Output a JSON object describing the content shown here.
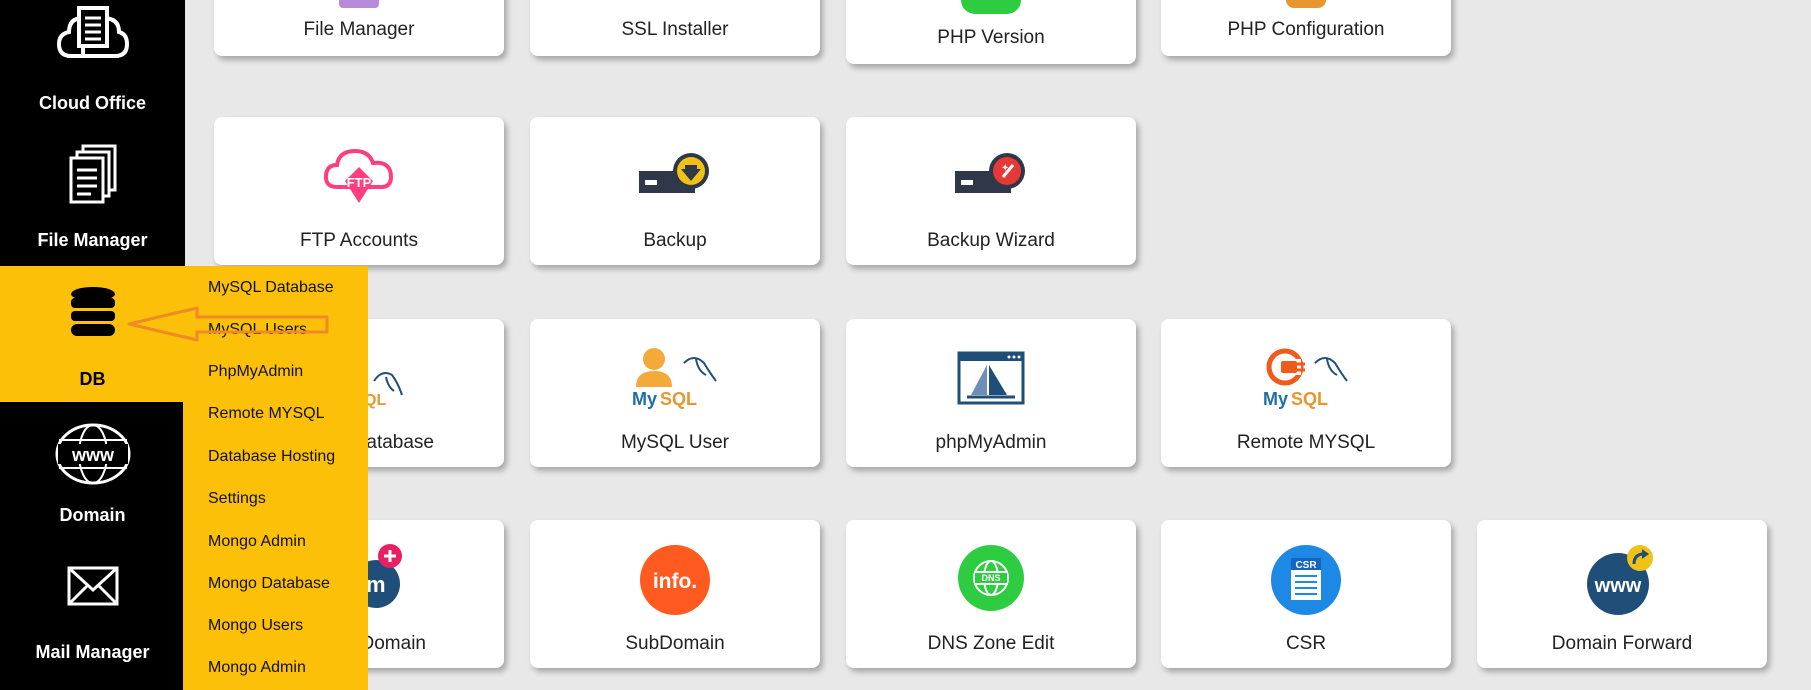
{
  "sidebar": {
    "items": [
      {
        "label": "Cloud Office",
        "icon": "cloud-office-icon"
      },
      {
        "label": "File Manager",
        "icon": "file-manager-icon"
      },
      {
        "label": "DB",
        "icon": "database-icon",
        "active": true
      },
      {
        "label": "Domain",
        "icon": "www-globe-icon"
      },
      {
        "label": "Mail Manager",
        "icon": "mail-envelope-icon"
      }
    ]
  },
  "submenu": {
    "items": [
      "MySQL Database",
      "MySQL Users",
      "PhpMyAdmin",
      "Remote MYSQL",
      "Database Hosting",
      "Settings",
      "Mongo Admin",
      "Mongo Database",
      "Mongo Users",
      "Mongo Admin"
    ]
  },
  "cards": {
    "row1": [
      "File Manager",
      "SSL Installer",
      "PHP Version",
      "PHP Configuration"
    ],
    "row2": [
      "FTP Accounts",
      "Backup",
      "Backup Wizard"
    ],
    "row3": [
      "atabase",
      "MySQL User",
      "phpMyAdmin",
      "Remote MYSQL"
    ],
    "row4": [
      "Domain",
      "SubDomain",
      "DNS Zone Edit",
      "CSR",
      "Domain Forward"
    ]
  },
  "icon_text": {
    "ftp": "FTP",
    "info": "info.",
    "csr": "CSR",
    "www": "www",
    "mysql": "MySQL",
    "m": "m",
    "dns": "DNS"
  },
  "colors": {
    "sidebar_bg": "#000000",
    "active_bg": "#fcc009",
    "arrow": "#f08a24",
    "ftp_pink": "#ff3d7f",
    "info_orange": "#ff5a1f",
    "dns_green": "#2ecc40",
    "csr_blue": "#1e88e5",
    "www_navy": "#1f4e79"
  }
}
